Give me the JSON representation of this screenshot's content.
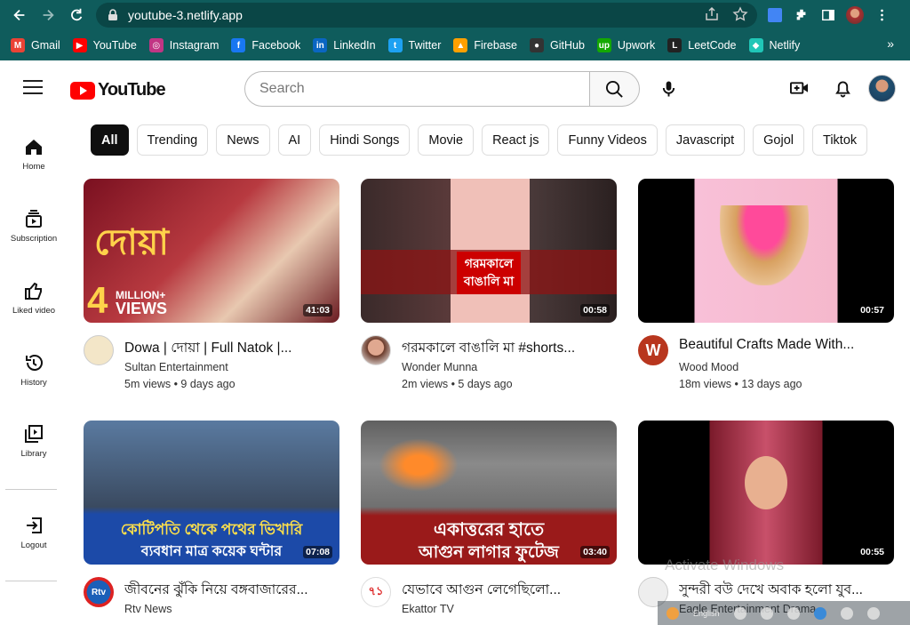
{
  "browser": {
    "url": "youtube-3.netlify.app",
    "bookmarks": [
      {
        "label": "Gmail",
        "color": "#ea4335",
        "glyph": "M"
      },
      {
        "label": "YouTube",
        "color": "#ff0000",
        "glyph": "▶"
      },
      {
        "label": "Instagram",
        "color": "#c13584",
        "glyph": "◎"
      },
      {
        "label": "Facebook",
        "color": "#1877f2",
        "glyph": "f"
      },
      {
        "label": "LinkedIn",
        "color": "#0a66c2",
        "glyph": "in"
      },
      {
        "label": "Twitter",
        "color": "#1da1f2",
        "glyph": "t"
      },
      {
        "label": "Firebase",
        "color": "#ffa000",
        "glyph": "▲"
      },
      {
        "label": "GitHub",
        "color": "#333333",
        "glyph": "●"
      },
      {
        "label": "Upwork",
        "color": "#14a800",
        "glyph": "up"
      },
      {
        "label": "LeetCode",
        "color": "#222222",
        "glyph": "L"
      },
      {
        "label": "Netlify",
        "color": "#20c6b7",
        "glyph": "◆"
      }
    ],
    "more": "»"
  },
  "header": {
    "logo_text": "YouTube",
    "search_placeholder": "Search"
  },
  "sidebar": {
    "items": [
      {
        "label": "Home",
        "icon": "home-icon"
      },
      {
        "label": "Subscription",
        "icon": "subscription-icon"
      },
      {
        "label": "Liked video",
        "icon": "thumbs-up-icon"
      },
      {
        "label": "History",
        "icon": "history-icon"
      },
      {
        "label": "Library",
        "icon": "library-icon"
      },
      {
        "label": "Logout",
        "icon": "logout-icon"
      }
    ]
  },
  "chips": [
    "All",
    "Trending",
    "News",
    "AI",
    "Hindi Songs",
    "Movie",
    "React js",
    "Funny Videos",
    "Javascript",
    "Gojol",
    "Tiktok"
  ],
  "videos": [
    {
      "title": "Dowa | দোয়া | Full Natok |...",
      "channel": "Sultan Entertainment",
      "stats": "5m views • 9 days ago",
      "duration": "41:03",
      "thumb_color": "#8a1c2a",
      "avatar_color": "#caa66a"
    },
    {
      "title": "গরমকালে বাঙালি মা #shorts...",
      "channel": "Wonder Munna",
      "stats": "2m views • 5 days ago",
      "duration": "00:58",
      "thumb_color": "#6a1818",
      "avatar_color": "#d89a7a"
    },
    {
      "title": "Beautiful Crafts Made With...",
      "channel": "Wood Mood",
      "stats": "18m views • 13 days ago",
      "duration": "00:57",
      "thumb_color": "#0a0a0a",
      "avatar_color": "#b8361e"
    },
    {
      "title": "জীবনের ঝুঁকি নিয়ে বঙ্গবাজারের...",
      "channel": "Rtv News",
      "stats": "",
      "duration": "07:08",
      "thumb_color": "#1c4aa8",
      "avatar_color": "#1b5fb8"
    },
    {
      "title": "যেভাবে আগুন লেগেছিলো...",
      "channel": "Ekattor TV",
      "stats": "",
      "duration": "03:40",
      "thumb_color": "#8a1a1a",
      "avatar_color": "#d22a2a"
    },
    {
      "title": "সুন্দরী বউ দেখে অবাক হলো যুব...",
      "channel": "Eagle Entertainment Drama",
      "stats": "",
      "duration": "00:55",
      "thumb_color": "#0a0a0a",
      "avatar_color": "#7a1a2a"
    }
  ],
  "thumb_text": {
    "v1_big": "4",
    "v1_small1": "MILLION+",
    "v1_small2": "VIEWS",
    "v1_bn": "দোয়া",
    "v2_line1": "গরমকালে",
    "v2_line2": "বাঙালি মা",
    "v4_line1": "কোটিপতি থেকে পথের ভিখারি",
    "v4_line2": "ব্যবধান মাত্র কয়েক ঘন্টার",
    "v5_line1": "একাত্তরের হাতে",
    "v5_line2": "আগুন লাগার ফুটেজ"
  },
  "watermark": {
    "activate": "Activate Windows",
    "lang": "English"
  }
}
